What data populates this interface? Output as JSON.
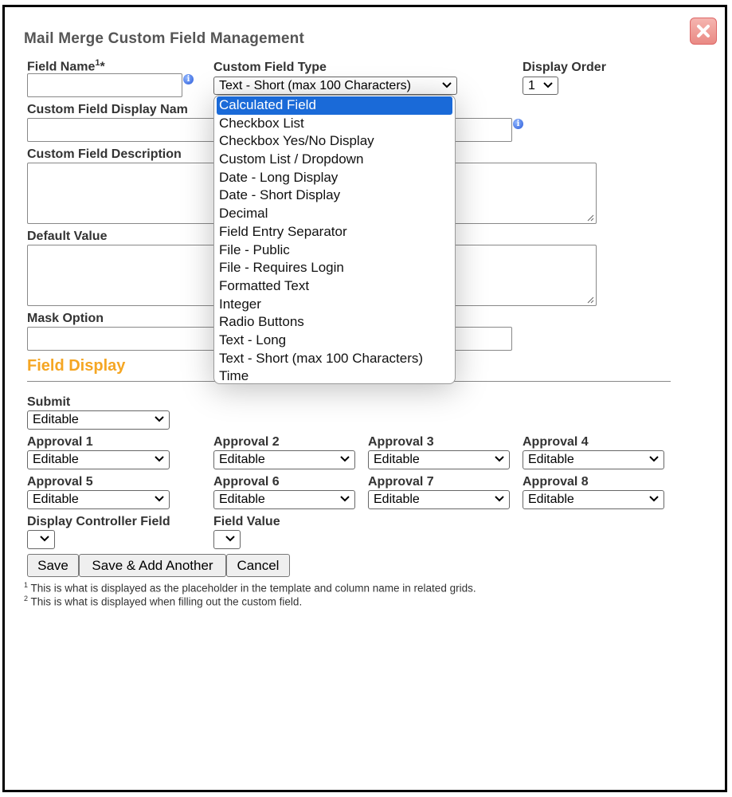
{
  "dialog": {
    "title": "Mail Merge Custom Field Management",
    "close_icon": "close-icon"
  },
  "fields": {
    "field_name": {
      "label": "Field Name",
      "superscript": "1",
      "required_mark": "*",
      "value": ""
    },
    "custom_field_type": {
      "label": "Custom Field Type",
      "selected": "Text - Short (max 100 Characters)"
    },
    "display_order": {
      "label": "Display Order",
      "selected": "1"
    },
    "display_name": {
      "label": "Custom Field Display Nam",
      "value": ""
    },
    "description": {
      "label": "Custom Field Description",
      "value": ""
    },
    "default_value": {
      "label": "Default Value",
      "value": ""
    },
    "mask_option": {
      "label": "Mask Option",
      "value": ""
    }
  },
  "type_options": [
    "Calculated Field",
    "Checkbox List",
    "Checkbox Yes/No Display",
    "Custom List / Dropdown",
    "Date - Long Display",
    "Date - Short Display",
    "Decimal",
    "Field Entry Separator",
    "File - Public",
    "File - Requires Login",
    "Formatted Text",
    "Integer",
    "Radio Buttons",
    "Text - Long",
    "Text - Short (max 100 Characters)",
    "Time"
  ],
  "highlighted_option": "Calculated Field",
  "field_display": {
    "title": "Field Display",
    "submit": {
      "label": "Submit",
      "value": "Editable"
    },
    "approvals": [
      {
        "label": "Approval 1",
        "value": "Editable"
      },
      {
        "label": "Approval 2",
        "value": "Editable"
      },
      {
        "label": "Approval 3",
        "value": "Editable"
      },
      {
        "label": "Approval 4",
        "value": "Editable"
      },
      {
        "label": "Approval 5",
        "value": "Editable"
      },
      {
        "label": "Approval 6",
        "value": "Editable"
      },
      {
        "label": "Approval 7",
        "value": "Editable"
      },
      {
        "label": "Approval 8",
        "value": "Editable"
      }
    ],
    "controller_field": {
      "label": "Display Controller Field",
      "value": ""
    },
    "field_value": {
      "label": "Field Value",
      "value": ""
    }
  },
  "buttons": {
    "save": "Save",
    "save_add": "Save & Add Another",
    "cancel": "Cancel"
  },
  "footnotes": [
    {
      "num": "1",
      "text": "This is what is displayed as the placeholder in the template and column name in related grids."
    },
    {
      "num": "2",
      "text": "This is what is displayed when filling out the custom field."
    }
  ],
  "colors": {
    "section_title": "#f5a623",
    "highlight": "#1a6ad8",
    "close_button": "#e98a84"
  }
}
